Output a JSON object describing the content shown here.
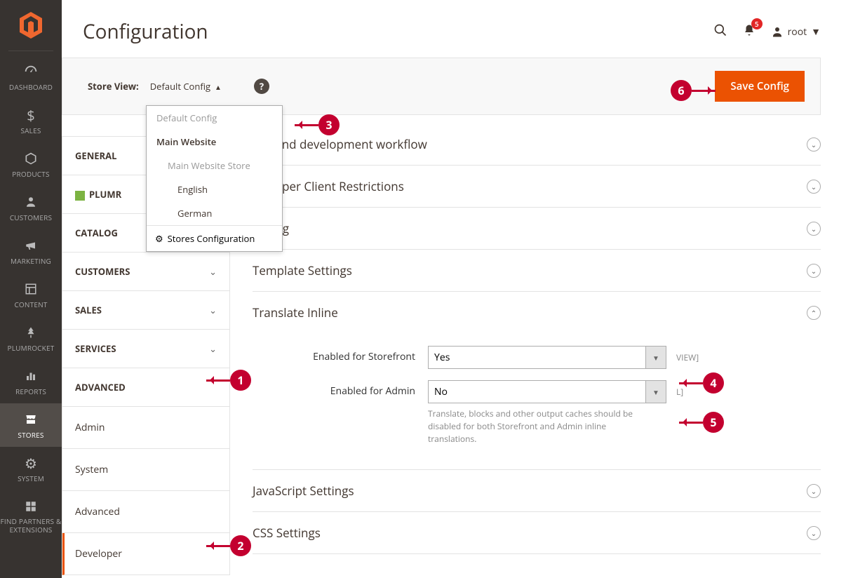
{
  "page_title": "Configuration",
  "notifications_count": "5",
  "username": "root",
  "sidebar": {
    "items": [
      {
        "label": "DASHBOARD",
        "icon": "dashboard"
      },
      {
        "label": "SALES",
        "icon": "dollar"
      },
      {
        "label": "PRODUCTS",
        "icon": "cube"
      },
      {
        "label": "CUSTOMERS",
        "icon": "person"
      },
      {
        "label": "MARKETING",
        "icon": "megaphone"
      },
      {
        "label": "CONTENT",
        "icon": "layout"
      },
      {
        "label": "PLUMROCKET",
        "icon": "tree"
      },
      {
        "label": "REPORTS",
        "icon": "bars"
      },
      {
        "label": "STORES",
        "icon": "store",
        "active": true
      },
      {
        "label": "SYSTEM",
        "icon": "gear"
      },
      {
        "label": "FIND PARTNERS\n& EXTENSIONS",
        "icon": "blocks"
      }
    ]
  },
  "store_view": {
    "label": "Store View:",
    "current": "Default Config",
    "options": {
      "default_config": "Default Config",
      "main_website": "Main Website",
      "main_website_store": "Main Website Store",
      "english": "English",
      "german": "German",
      "stores_config": "Stores Configuration"
    }
  },
  "save_button": "Save Config",
  "config_nav": {
    "general": "GENERAL",
    "plumrocket": "PLUMR",
    "catalog": "CATALOG",
    "customers": "CUSTOMERS",
    "sales": "SALES",
    "services": "SERVICES",
    "advanced": "ADVANCED",
    "advanced_children": {
      "admin": "Admin",
      "system": "System",
      "advanced": "Advanced",
      "developer": "Developer"
    }
  },
  "groups": {
    "frontend_workflow": "ont-end development workflow",
    "dev_restrictions": "eveloper Client Restrictions",
    "debug": "Debug",
    "template_settings": "Template Settings",
    "translate_inline": "Translate Inline",
    "javascript_settings": "JavaScript Settings",
    "css_settings": "CSS Settings"
  },
  "translate_inline": {
    "storefront_label": "Enabled for Storefront",
    "storefront_value": "Yes",
    "storefront_scope": "VIEW]",
    "admin_label": "Enabled for Admin",
    "admin_value": "No",
    "admin_scope": "L]",
    "note": "Translate, blocks and other output caches should be disabled for both Storefront and Admin inline translations."
  }
}
